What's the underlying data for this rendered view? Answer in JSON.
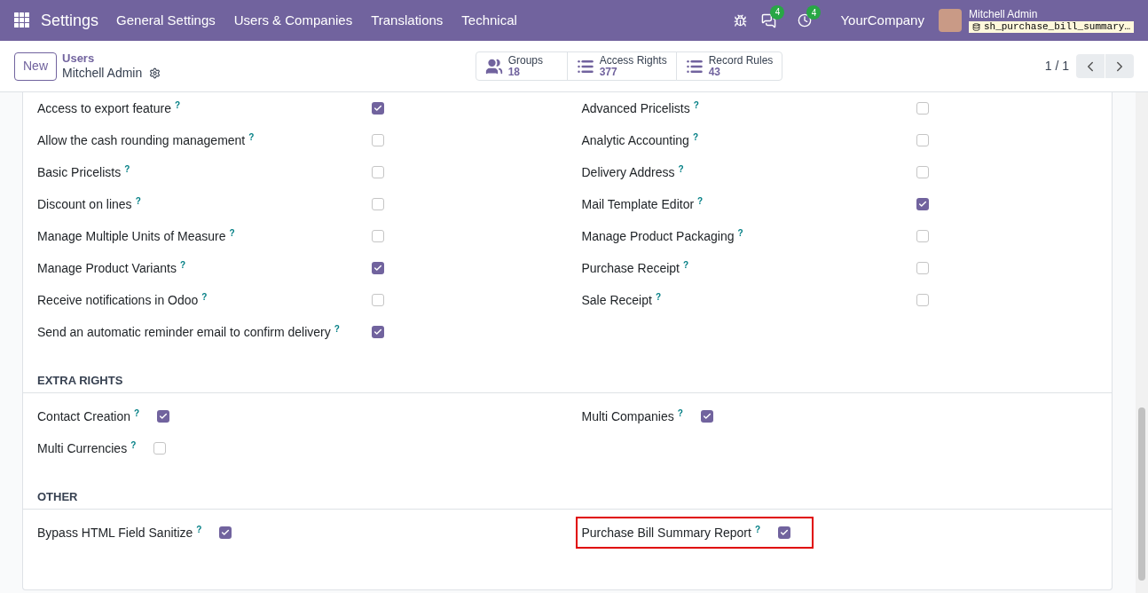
{
  "navbar": {
    "app_title": "Settings",
    "menu": [
      "General Settings",
      "Users & Companies",
      "Translations",
      "Technical"
    ],
    "messages_badge": "4",
    "activities_badge": "4",
    "company": "YourCompany",
    "user_name": "Mitchell Admin",
    "database": "sh_purchase_bill_summary…"
  },
  "control_panel": {
    "new_button": "New",
    "breadcrumb_parent": "Users",
    "record_name": "Mitchell Admin",
    "smart_buttons": [
      {
        "kind": "groups",
        "label": "Groups",
        "value": "18"
      },
      {
        "kind": "list",
        "label": "Access Rights",
        "value": "377"
      },
      {
        "kind": "list",
        "label": "Record Rules",
        "value": "43"
      }
    ],
    "pager": "1 / 1"
  },
  "sections": [
    {
      "kind": "aligned",
      "columns": [
        [
          {
            "label": "Access to export feature",
            "help": "?",
            "checked": true
          },
          {
            "label": "Allow the cash rounding management",
            "help": "?",
            "checked": false
          },
          {
            "label": "Basic Pricelists",
            "help": "?",
            "checked": false
          },
          {
            "label": "Discount on lines",
            "help": "?",
            "checked": false
          },
          {
            "label": "Manage Multiple Units of Measure",
            "help": "?",
            "checked": false
          },
          {
            "label": "Manage Product Variants",
            "help": "?",
            "checked": true
          },
          {
            "label": "Receive notifications in Odoo",
            "help": "?",
            "checked": false
          },
          {
            "label": "Send an automatic reminder email to confirm delivery",
            "help": "?",
            "checked": true
          }
        ],
        [
          {
            "label": "Advanced Pricelists",
            "help": "?",
            "checked": false
          },
          {
            "label": "Analytic Accounting",
            "help": "?",
            "checked": false
          },
          {
            "label": "Delivery Address",
            "help": "?",
            "checked": false
          },
          {
            "label": "Mail Template Editor",
            "help": "?",
            "checked": true
          },
          {
            "label": "Manage Product Packaging",
            "help": "?",
            "checked": false
          },
          {
            "label": "Purchase Receipt",
            "help": "?",
            "checked": false
          },
          {
            "label": "Sale Receipt",
            "help": "?",
            "checked": false
          }
        ]
      ]
    },
    {
      "kind": "inline",
      "title": "EXTRA RIGHTS",
      "columns": [
        [
          {
            "label": "Contact Creation",
            "help": "?",
            "checked": true
          },
          {
            "label": "Multi Currencies",
            "help": "?",
            "checked": false
          }
        ],
        [
          {
            "label": "Multi Companies",
            "help": "?",
            "checked": true
          }
        ]
      ]
    },
    {
      "kind": "inline",
      "title": "OTHER",
      "columns": [
        [
          {
            "label": "Bypass HTML Field Sanitize",
            "help": "?",
            "checked": true
          }
        ],
        [
          {
            "label": "Purchase Bill Summary Report",
            "help": "?",
            "checked": true,
            "highlighted": true
          }
        ]
      ]
    }
  ]
}
